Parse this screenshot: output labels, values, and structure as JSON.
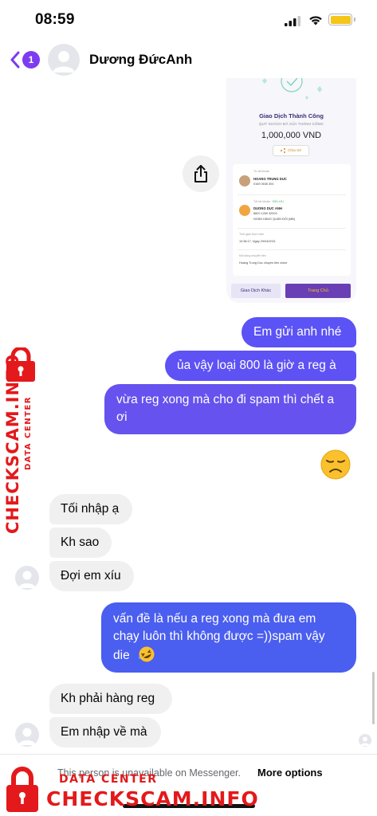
{
  "status_bar": {
    "time": "08:59"
  },
  "header": {
    "back_badge": "1",
    "contact_name": "Dương ĐứcAnh"
  },
  "shared_receipt": {
    "title": "Giao Dịch Thành Công",
    "subtitle": "QUÝ KHÁCH ĐÃ GỬI THÀNH CÔNG",
    "amount": "1,000,000 VND",
    "share_label": "Chia Sẻ",
    "from_label": "Từ tài khoản",
    "from_name": "HOANG TRUNG DUC",
    "from_account": "0169 0636 304",
    "to_label": "Tới tài khoản",
    "to_saved": "ĐÃ LƯU",
    "to_name": "DUONG DUC ANH",
    "to_account": "8820 1260 32003",
    "to_bank": "NGÂN HÀNG QUÂN ĐỘI (MB)",
    "time_label": "Thời gian thực hiện",
    "time_value": "10:38:17, Ngày 29/04/2021",
    "content_label": "Nội dung chuyển tiền",
    "content_value": "Hoang Trung Duc chuyen tien clone",
    "btn_other": "Giao Dịch Khác",
    "btn_home": "Trang Chủ"
  },
  "messages": [
    {
      "direction": "outgoing",
      "text": "Em gửi anh nhé"
    },
    {
      "direction": "outgoing",
      "text": "ủa vậy loại 800 là giờ a reg à"
    },
    {
      "direction": "outgoing",
      "text": "vừa reg xong mà cho đi spam thì chết a ơi"
    },
    {
      "direction": "outgoing",
      "text": "😞"
    },
    {
      "direction": "incoming",
      "text": "Tối nhập ạ"
    },
    {
      "direction": "incoming",
      "text": "Kh sao"
    },
    {
      "direction": "incoming",
      "text": "Đợi em xíu"
    },
    {
      "direction": "outgoing",
      "text": "vấn đề là nếu a reg xong mà đưa em chạy luôn thì không được =))spam vậy die 🤣"
    },
    {
      "direction": "incoming",
      "text": "Kh phải hàng reg"
    },
    {
      "direction": "incoming",
      "text": "Em nhập về mà"
    }
  ],
  "bottom_bar": {
    "unavailable_text": "This person is unavailable on Messenger.",
    "more_options": "More options"
  },
  "watermark": {
    "brand": "CHECKSCAM.INFO",
    "subtitle": "DATA CENTER"
  },
  "colors": {
    "outgoing_bubble": "#5b53f5",
    "incoming_bubble": "#f0f0f0",
    "accent": "#7d3cf0",
    "watermark": "#e3191b"
  }
}
